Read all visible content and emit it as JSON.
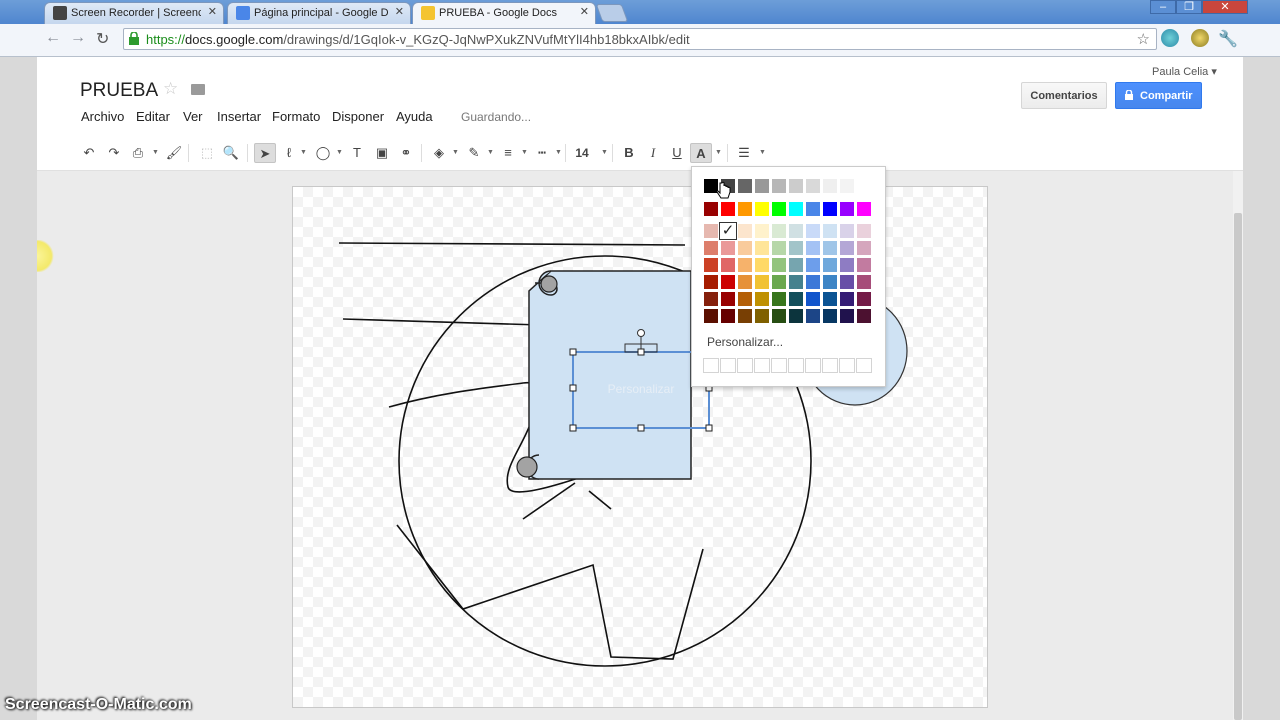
{
  "browser": {
    "tabs": [
      {
        "label": "Screen Recorder | Screencast",
        "active": false
      },
      {
        "label": "Página principal - Google Drive",
        "active": false
      },
      {
        "label": "PRUEBA - Google Docs",
        "active": true
      }
    ],
    "url_protocol": "https://",
    "url_host": "docs.google.com",
    "url_path": "/drawings/d/1GqIok-v_KGzQ-JqNwPXukZNVufMtYlI4hb18bkxAIbk/edit"
  },
  "doc": {
    "title": "PRUEBA",
    "menu": [
      "Archivo",
      "Editar",
      "Ver",
      "Insertar",
      "Formato",
      "Disponer",
      "Ayuda"
    ],
    "status": "Guardando...",
    "user": "Paula Celia ▾",
    "comments_label": "Comentarios",
    "share_label": "Compartir"
  },
  "toolbar": {
    "font_size": "14",
    "bold": "B",
    "italic": "I",
    "underline": "U",
    "text_color": "A"
  },
  "palette": {
    "custom_label": "Personalizar...",
    "selected_color": "#f4cccc",
    "checkmark": "✓",
    "rows": [
      [
        "#000000",
        "#434343",
        "#666666",
        "#999999",
        "#b7b7b7",
        "#cccccc",
        "#d9d9d9",
        "#efefef",
        "#f3f3f3",
        "#ffffff"
      ],
      [
        "#980000",
        "#ff0000",
        "#ff9900",
        "#ffff00",
        "#00ff00",
        "#00ffff",
        "#4a86e8",
        "#0000ff",
        "#9900ff",
        "#ff00ff"
      ],
      [
        "#e6b8af",
        "#f4cccc",
        "#fce5cd",
        "#fff2cc",
        "#d9ead3",
        "#d0e0e3",
        "#c9daf8",
        "#cfe2f3",
        "#d9d2e9",
        "#ead1dc"
      ],
      [
        "#dd7e6b",
        "#ea9999",
        "#f9cb9c",
        "#ffe599",
        "#b6d7a8",
        "#a2c4c9",
        "#a4c2f4",
        "#9fc5e8",
        "#b4a7d6",
        "#d5a6bd"
      ],
      [
        "#cc4125",
        "#e06666",
        "#f6b26b",
        "#ffd966",
        "#93c47d",
        "#76a5af",
        "#6d9eeb",
        "#6fa8dc",
        "#8e7cc3",
        "#c27ba0"
      ],
      [
        "#a61c00",
        "#cc0000",
        "#e69138",
        "#f1c232",
        "#6aa84f",
        "#45818e",
        "#3c78d8",
        "#3d85c6",
        "#674ea7",
        "#a64d79"
      ],
      [
        "#85200c",
        "#990000",
        "#b45f06",
        "#bf9000",
        "#38761d",
        "#134f5c",
        "#1155cc",
        "#0b5394",
        "#351c75",
        "#741b47"
      ],
      [
        "#5b0f00",
        "#660000",
        "#783f04",
        "#7f6000",
        "#274e13",
        "#0c343d",
        "#1c4587",
        "#073763",
        "#20124d",
        "#4c1130"
      ]
    ]
  },
  "drawing": {
    "placeholder_text": "Personalizar"
  },
  "watermark": "Screencast-O-Matic.com"
}
